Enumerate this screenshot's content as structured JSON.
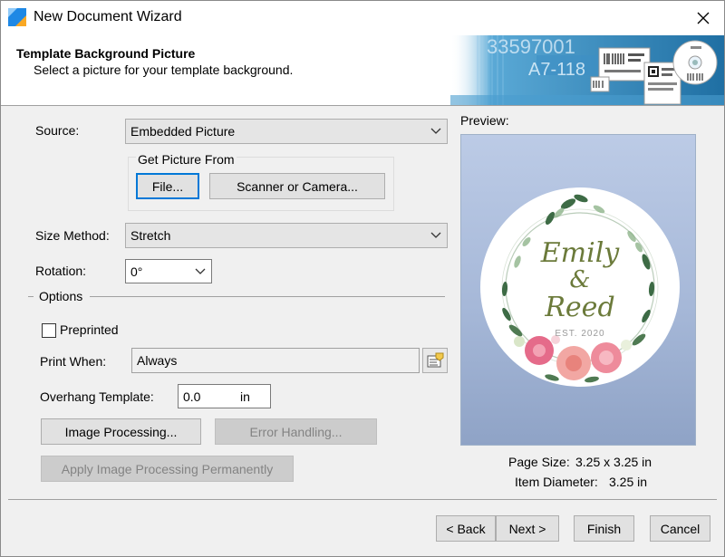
{
  "window": {
    "title": "New Document Wizard"
  },
  "header": {
    "title": "Template Background Picture",
    "subtitle": "Select a picture for your template background."
  },
  "banner": {
    "number_text": "33597001",
    "code_text": "A7-118"
  },
  "form": {
    "source_label": "Source:",
    "source_value": "Embedded Picture",
    "get_picture_from_label": "Get Picture From",
    "file_button": "File...",
    "scanner_button": "Scanner or Camera...",
    "size_method_label": "Size Method:",
    "size_method_value": "Stretch",
    "rotation_label": "Rotation:",
    "rotation_value": "0°",
    "options_label": "Options",
    "preprinted_label": "Preprinted",
    "preprinted_checked": false,
    "print_when_label": "Print When:",
    "print_when_value": "Always",
    "overhang_label": "Overhang Template:",
    "overhang_value": "0.0",
    "overhang_unit": "in",
    "image_processing_button": "Image Processing...",
    "error_handling_button": "Error Handling...",
    "apply_image_processing_button": "Apply Image Processing Permanently"
  },
  "preview": {
    "label": "Preview:",
    "name_line1": "Emily",
    "ampersand": "&",
    "name_line2": "Reed",
    "est": "EST. 2020",
    "page_size_label": "Page Size:",
    "page_size_value": "3.25 x 3.25 in",
    "item_diameter_label": "Item Diameter:",
    "item_diameter_value": "3.25 in"
  },
  "footer": {
    "back_button": "< Back",
    "next_button": "Next >",
    "finish_button": "Finish",
    "cancel_button": "Cancel"
  },
  "colors": {
    "accent": "#0078d7",
    "window_bg": "#f0f0f0",
    "preview_bg": "#a6b8d8",
    "banner_blue": "#2f8bc4"
  },
  "icons": {
    "app": "app-logo-icon",
    "close": "close-icon",
    "dropdown": "chevron-down-icon",
    "print_when_picker": "formula-picker-icon"
  }
}
